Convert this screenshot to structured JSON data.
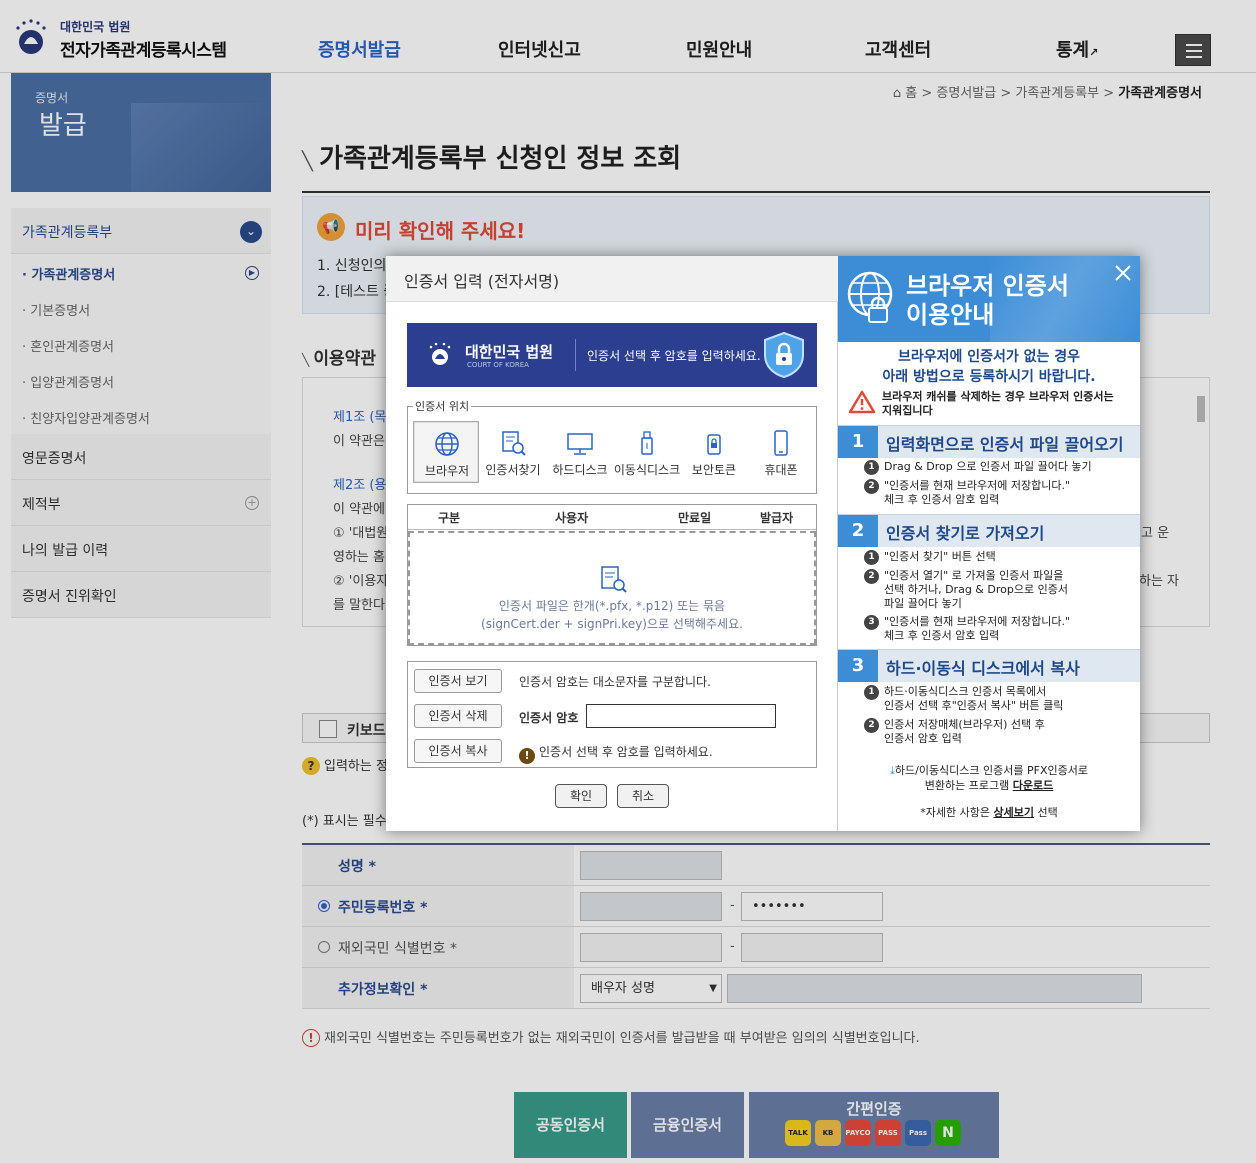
{
  "header": {
    "logo_sub": "대한민국 법원",
    "logo_main": "전자가족관계등록시스템",
    "nav": [
      "증명서발급",
      "인터넷신고",
      "민원안내",
      "고객센터",
      "통계"
    ],
    "nav_active_color": "#2b62c9"
  },
  "side": {
    "banner_line1": "증명서",
    "banner_line2": "발급",
    "groups": [
      {
        "label": "가족관계등록부"
      },
      {
        "label": "영문증명서"
      },
      {
        "label": "제적부"
      },
      {
        "label": "나의 발급 이력"
      },
      {
        "label": "증명서 진위확인"
      }
    ],
    "sub_items": [
      {
        "label": "· 가족관계증명서"
      },
      {
        "label": "· 기본증명서"
      },
      {
        "label": "· 혼인관계증명서"
      },
      {
        "label": "· 입양관계증명서"
      },
      {
        "label": "· 친양자입양관계증명서"
      }
    ]
  },
  "breadcrumb": {
    "home": "홈",
    "items": [
      "증명서발급",
      "가족관계등록부"
    ],
    "current": "가족관계증명서"
  },
  "page": {
    "title": "가족관계등록부 신청인 정보 조회",
    "notice_title": "미리 확인해 주세요!",
    "notice_lines": [
      "1. 신청인의",
      "2. [테스트 증"
    ],
    "terms_title": "이용약관",
    "terms_lines": [
      "제1조 (목적",
      "이 약관은",
      "제2조 (용어",
      "이 약관에",
      "① '대법원",
      "영하는 홈",
      "② '이용자",
      "를 말한다"
    ],
    "terms_right": [
      "고 운",
      "하는 자"
    ],
    "keyboard_label": "키보드",
    "help_text": "입력하는 정",
    "required_note": "(*) 표시는 필수",
    "form": {
      "name_label": "성명",
      "rrn_label": "주민등록번호",
      "rrn_back": "•••••••",
      "foreign_label": "재외국민 식별번호",
      "extra_label": "추가정보확인",
      "extra_select": "배우자 성명",
      "required_mark": "*"
    },
    "foreign_note": "재외국민 식별번호는 주민등록번호가 없는 재외국민이 인증서를 발급받을 때 부여받은 임의의 식별번호입니다.",
    "auth_buttons": {
      "public": "공동인증서",
      "finance": "금융인증서",
      "simple": "간편인증"
    },
    "pay_icons": [
      "TALK",
      "KB",
      "PAYCO",
      "PASS",
      "Pass",
      "N"
    ]
  },
  "modal": {
    "title": "인증서 입력 (전자서명)",
    "court_name": "대한민국 법원",
    "court_en": "COURT OF KOREA",
    "court_msg": "인증서 선택 후 암호를 입력하세요.",
    "location_legend": "인증서 위치",
    "locations": [
      "브라우저",
      "인증서찾기",
      "하드디스크",
      "이동식디스크",
      "보안토큰",
      "휴대폰"
    ],
    "columns": [
      "구분",
      "사용자",
      "만료일",
      "발급자"
    ],
    "drop_line1": "인증서 파일은 한개(*.pfx, *.p12) 또는 묶음",
    "drop_line2": "(signCert.der + signPri.key)으로 선택해주세요.",
    "btn_view": "인증서 보기",
    "btn_delete": "인증서 삭제",
    "btn_copy": "인증서 복사",
    "case_note": "인증서 암호는 대소문자를 구분합니다.",
    "pw_label": "인증서 암호",
    "pw_value": "",
    "select_warn": "인증서 선택 후 암호를 입력하세요.",
    "confirm": "확인",
    "cancel": "취소"
  },
  "guide": {
    "title1": "브라우저 인증서",
    "title2": "이용안내",
    "intro1": "브라우저에 인증서가 없는 경우",
    "intro2": "아래 방법으로 등록하시기 바랍니다.",
    "warn1": "브라우저 캐쉬를 삭제하는 경우 브라우저 인증서는",
    "warn2": "지워집니다",
    "steps": [
      {
        "num": "1",
        "title": "입력화면으로 인증서 파일 끌어오기",
        "items": [
          [
            "Drag & Drop 으로 인증서 파일 끌어다 놓기"
          ],
          [
            "\"인증서를 현재 브라우저에 저장합니다.\"",
            "체크 후 인증서 암호 입력"
          ]
        ]
      },
      {
        "num": "2",
        "title": "인증서 찾기로 가져오기",
        "items": [
          [
            "\"인증서 찾기\" 버튼 선택"
          ],
          [
            "\"인증서 열기\" 로 가져올 인증서 파일을",
            "선택 하거나, Drag & Drop으로 인증서",
            "파일 끌어다 놓기"
          ],
          [
            "\"인증서를 현재 브라우저에 저장합니다.\"",
            "체크 후 인증서 암호 입력"
          ]
        ]
      },
      {
        "num": "3",
        "title": "하드·이동식 디스크에서 복사",
        "items": [
          [
            "하드·이동식디스크 인증서 목록에서",
            "인증서 선택 후\"인증서 복사\" 버튼 클릭"
          ],
          [
            "인증서 저장매체(브라우저) 선택 후",
            "인증서 암호 입력"
          ]
        ]
      }
    ],
    "download1": "하드/이동식디스크 인증서를 PFX인증서로",
    "download2_pre": "변환하는 프로그램 ",
    "download_link": "다운로드",
    "detail_pre": "*자세한 사항은 ",
    "detail_link": "상세보기",
    "detail_post": " 선택"
  },
  "colors": {
    "accent": "#3c8dd6",
    "court_banner": "#2c3e8f",
    "notice_red": "#e04a3a",
    "auth_green": "#3a9d8a",
    "auth_slate": "#6a7fa8"
  }
}
